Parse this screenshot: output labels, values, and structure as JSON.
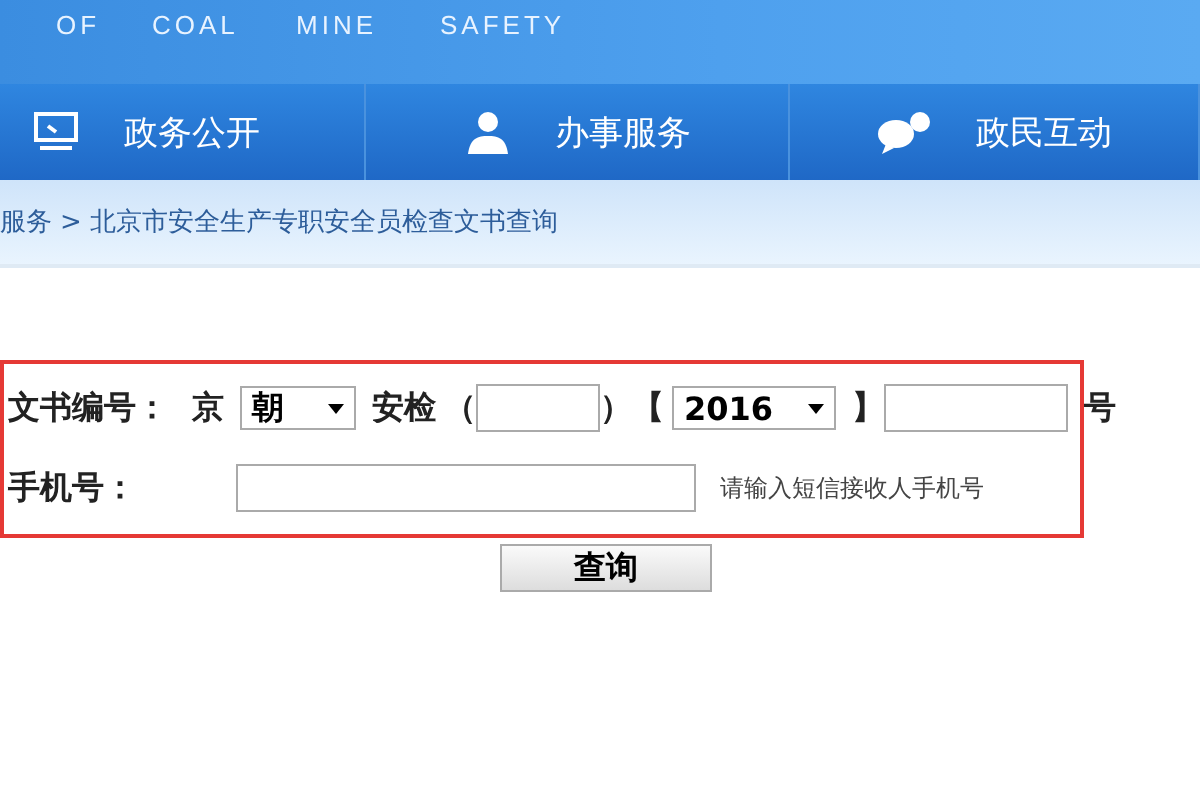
{
  "header": {
    "tagline": [
      "OF",
      "COAL",
      "MINE",
      "SAFETY"
    ]
  },
  "nav": [
    {
      "label": "政务公开"
    },
    {
      "label": "办事服务"
    },
    {
      "label": "政民互动"
    }
  ],
  "breadcrumb": {
    "parent": "服务",
    "separator": ">",
    "current": "北京市安全生产专职安全员检查文书查询"
  },
  "form": {
    "doc_label": "文书编号：",
    "prefix": "京",
    "district": "朝",
    "middle": "安检",
    "open_paren": "（",
    "close_paren": "）",
    "open_bracket": "【",
    "year": "2016",
    "close_bracket": "】",
    "suffix": "号",
    "phone_label": "手机号：",
    "phone_hint": "请输入短信接收人手机号",
    "submit": "查询"
  }
}
